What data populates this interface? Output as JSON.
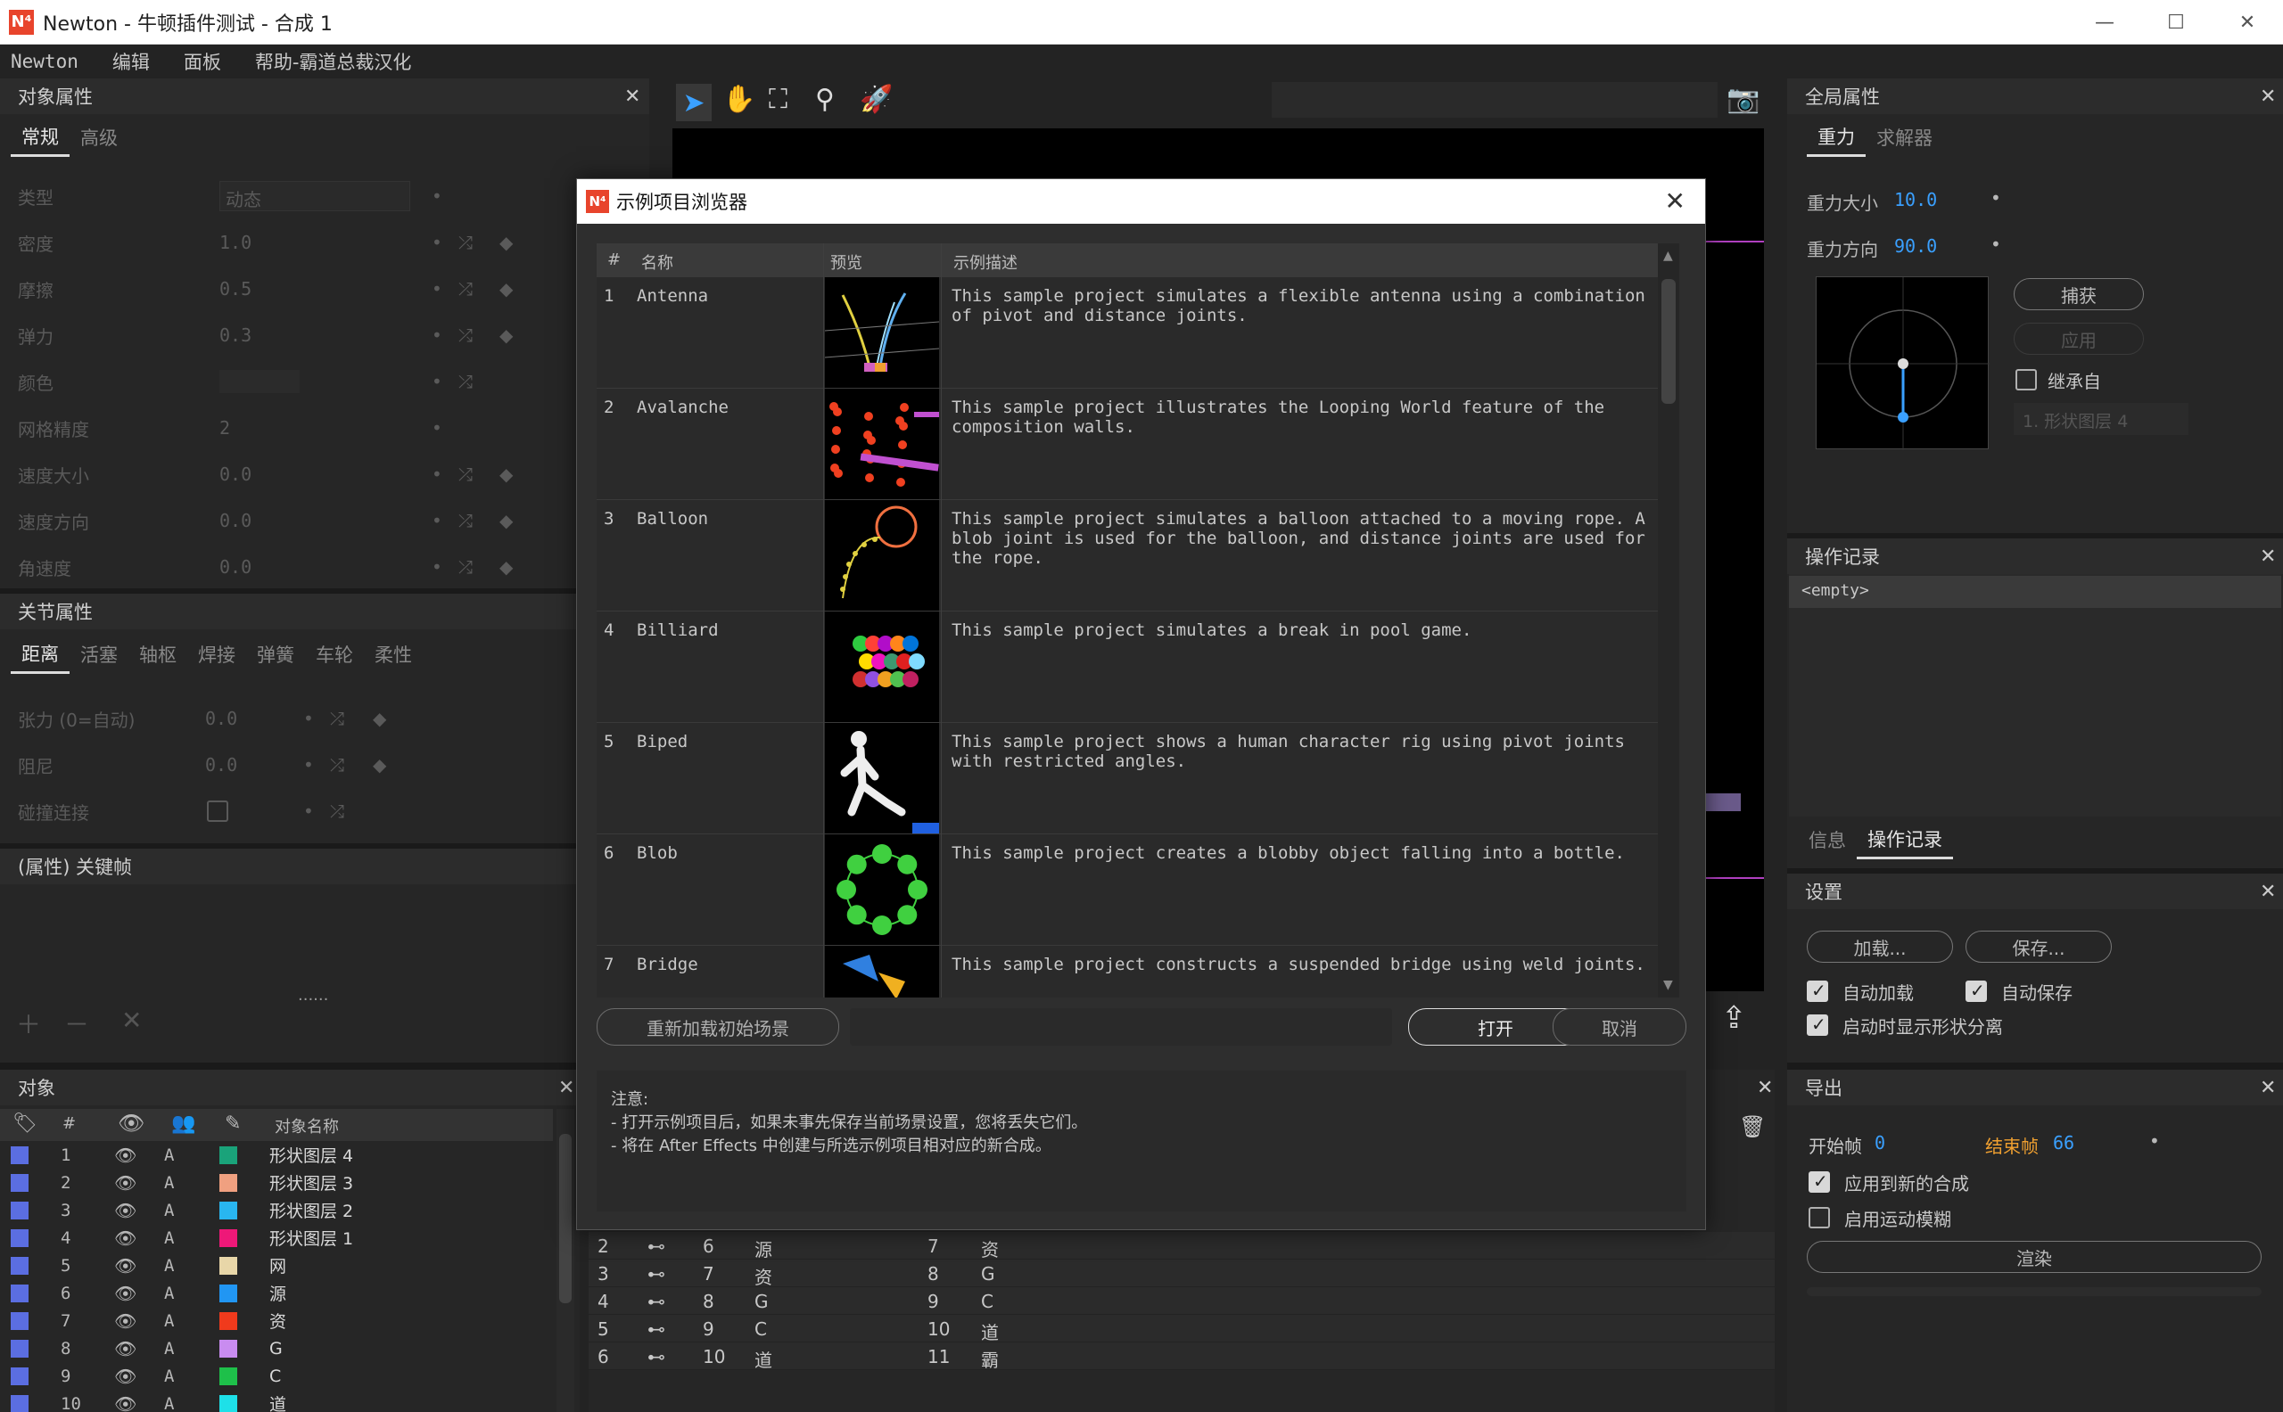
{
  "window": {
    "title": "Newton - 牛顿插件测试 - 合成 1",
    "app_icon": "N⁴",
    "minimize": "—",
    "maximize": "☐",
    "close": "✕"
  },
  "menu": [
    "Newton",
    "编辑",
    "面板",
    "帮助-霸道总裁汉化"
  ],
  "object_props": {
    "title": "对象属性",
    "tabs": [
      "常规",
      "高级"
    ],
    "rows": [
      {
        "label": "类型",
        "value": "动态"
      },
      {
        "label": "密度",
        "value": "1.0"
      },
      {
        "label": "摩擦",
        "value": "0.5"
      },
      {
        "label": "弹力",
        "value": "0.3"
      },
      {
        "label": "颜色",
        "value": ""
      },
      {
        "label": "网格精度",
        "value": "2"
      },
      {
        "label": "速度大小",
        "value": "0.0"
      },
      {
        "label": "速度方向",
        "value": "0.0"
      },
      {
        "label": "角速度",
        "value": "0.0"
      }
    ]
  },
  "joint_props": {
    "title": "关节属性",
    "tabs": [
      "距离",
      "活塞",
      "轴枢",
      "焊接",
      "弹簧",
      "车轮",
      "柔性"
    ],
    "rows": [
      {
        "label": "张力 (0=自动)",
        "value": "0.0"
      },
      {
        "label": "阻尼",
        "value": "0.0"
      },
      {
        "label": "碰撞连接",
        "value": ""
      }
    ]
  },
  "keyframes": {
    "title": "(属性) 关键帧",
    "dots": "......"
  },
  "objects": {
    "title": "对象",
    "column_name": "对象名称",
    "column_hash": "#",
    "rows": [
      {
        "num": "1",
        "mode": "A",
        "color": "#1aa37a",
        "name": "形状图层 4"
      },
      {
        "num": "2",
        "mode": "A",
        "color": "#f0a080",
        "name": "形状图层 3"
      },
      {
        "num": "3",
        "mode": "A",
        "color": "#29b6f0",
        "name": "形状图层 2"
      },
      {
        "num": "4",
        "mode": "A",
        "color": "#ee1878",
        "name": "形状图层 1"
      },
      {
        "num": "5",
        "mode": "A",
        "color": "#e8d6a8",
        "name": "网"
      },
      {
        "num": "6",
        "mode": "A",
        "color": "#2196f3",
        "name": "源"
      },
      {
        "num": "7",
        "mode": "A",
        "color": "#f03a1c",
        "name": "资"
      },
      {
        "num": "8",
        "mode": "A",
        "color": "#c98cf0",
        "name": "G"
      },
      {
        "num": "9",
        "mode": "A",
        "color": "#1ec04a",
        "name": "C"
      },
      {
        "num": "10",
        "mode": "A",
        "color": "#1ee0e8",
        "name": "道"
      }
    ]
  },
  "joints_list": {
    "rows": [
      {
        "i": "2",
        "a": "6",
        "an": "源",
        "b": "7",
        "bn": "资"
      },
      {
        "i": "3",
        "a": "7",
        "an": "资",
        "b": "8",
        "bn": "G"
      },
      {
        "i": "4",
        "a": "8",
        "an": "G",
        "b": "9",
        "bn": "C"
      },
      {
        "i": "5",
        "a": "9",
        "an": "C",
        "b": "10",
        "bn": "道"
      },
      {
        "i": "6",
        "a": "10",
        "an": "道",
        "b": "11",
        "bn": "霸"
      }
    ]
  },
  "global_props": {
    "title": "全局属性",
    "tabs": [
      "重力",
      "求解器"
    ],
    "gravity_label": "重力大小",
    "gravity_value": "10.0",
    "direction_label": "重力方向",
    "direction_value": "90.0",
    "capture": "捕获",
    "apply": "应用",
    "inherit": "继承自",
    "inherit_select": "1. 形状图层 4"
  },
  "history": {
    "title": "操作记录",
    "item": "<empty>",
    "tabs": [
      "信息",
      "操作记录"
    ]
  },
  "settings": {
    "title": "设置",
    "load": "加载...",
    "save": "保存...",
    "auto_load": "自动加载",
    "auto_save": "自动保存",
    "show_separation": "启动时显示形状分离"
  },
  "export": {
    "title": "导出",
    "start_label": "开始帧",
    "start_value": "0",
    "end_label": "结束帧",
    "end_value": "66",
    "apply_new": "应用到新的合成",
    "motion_blur": "启用运动模糊",
    "render": "渲染"
  },
  "dialog": {
    "title": "示例项目浏览器",
    "close": "✕",
    "columns": {
      "num": "#",
      "name": "名称",
      "preview": "预览",
      "desc": "示例描述"
    },
    "rows": [
      {
        "num": "1",
        "name": "Antenna",
        "desc": "This sample project simulates a flexible antenna using a combination of pivot and distance joints."
      },
      {
        "num": "2",
        "name": "Avalanche",
        "desc": "This sample project illustrates the Looping World feature of the composition walls."
      },
      {
        "num": "3",
        "name": "Balloon",
        "desc": "This sample project simulates a balloon attached to a moving rope. A blob joint is used for the balloon, and distance joints are used for the rope."
      },
      {
        "num": "4",
        "name": "Billiard",
        "desc": "This sample project simulates a break in pool game."
      },
      {
        "num": "5",
        "name": "Biped",
        "desc": "This sample project shows a human character rig using pivot joints with restricted angles."
      },
      {
        "num": "6",
        "name": "Blob",
        "desc": "This sample project creates a blobby object falling into a bottle."
      },
      {
        "num": "7",
        "name": "Bridge",
        "desc": "This sample project constructs a suspended bridge using weld joints."
      }
    ],
    "reload": "重新加载初始场景",
    "open": "打开",
    "cancel": "取消",
    "note_title": "注意:",
    "note_1": "- 打开示例项目后，如果未事先保存当前场景设置，您将丢失它们。",
    "note_2": "- 将在 After Effects 中创建与所选示例项目相对应的新合成。"
  },
  "colors": {
    "accent": "#3aa0ff",
    "orange": "#f0a030",
    "bg": "#232323"
  }
}
